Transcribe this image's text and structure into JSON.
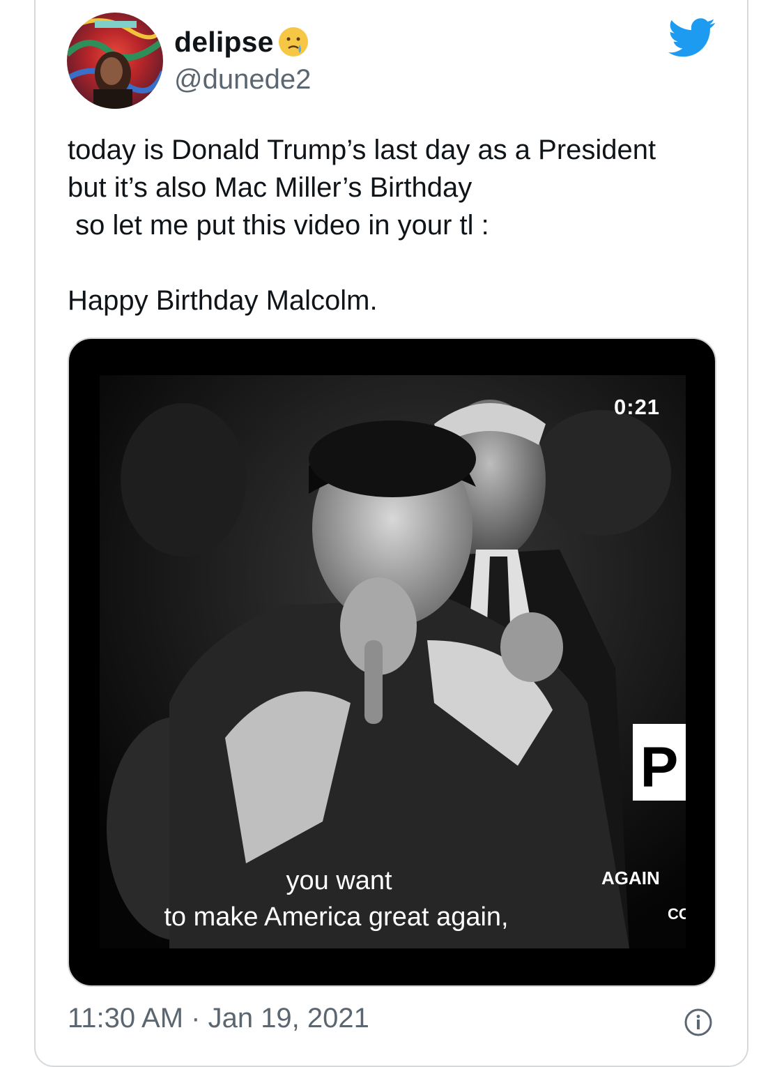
{
  "tweet": {
    "display_name": "delipse",
    "name_emoji": "crying-face-emoji",
    "handle": "@dunede2",
    "text": "today is Donald Trump’s last day as a President\nbut it’s also Mac Miller’s Birthday\n so let me put this video in your tl :\n\nHappy Birthday Malcolm.",
    "timestamp": "11:30 AM · Jan 19, 2021"
  },
  "video": {
    "duration": "0:21",
    "caption_line1": "you want",
    "caption_line2": "to make America great again,",
    "sign_text_1": "AGAIN",
    "sign_text_2": "P",
    "sign_text_3": "CC"
  },
  "icons": {
    "logo": "twitter-bird-icon",
    "info": "info-icon"
  },
  "colors": {
    "twitter_blue": "#1d9bf0",
    "secondary_text": "#5b6670",
    "border": "#d6d9dc"
  }
}
